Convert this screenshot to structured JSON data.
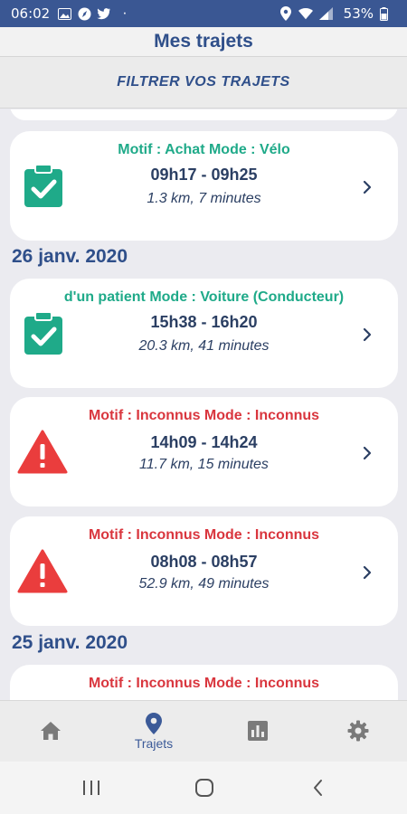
{
  "status_bar": {
    "time": "06:02",
    "battery": "53%",
    "dot": "·"
  },
  "header": {
    "title": "Mes trajets"
  },
  "filter": {
    "label": "FILTRER VOS TRAJETS"
  },
  "colors": {
    "primary": "#2f4f8a",
    "ok": "#1faa89",
    "warn": "#d9363e",
    "status_bar": "#3a5793"
  },
  "trips": [
    {
      "status": "ok",
      "icon": "clipboard-check-icon",
      "motif": "Motif : Achat  Mode : Vélo",
      "hours": "09h17 - 09h25",
      "details": "1.3 km, 7 minutes"
    },
    {
      "status": "ok",
      "icon": "clipboard-check-icon",
      "motif": "d'un patient  Mode : Voiture (Conducteur)",
      "hours": "15h38 - 16h20",
      "details": "20.3 km, 41 minutes"
    },
    {
      "status": "warn",
      "icon": "warning-triangle-icon",
      "motif": "Motif : Inconnus  Mode : Inconnus",
      "hours": "14h09 - 14h24",
      "details": "11.7 km, 15 minutes"
    },
    {
      "status": "warn",
      "icon": "warning-triangle-icon",
      "motif": "Motif : Inconnus  Mode : Inconnus",
      "hours": "08h08 - 08h57",
      "details": "52.9 km, 49 minutes"
    },
    {
      "status": "warn",
      "icon": "warning-triangle-icon",
      "motif": "Motif : Inconnus  Mode : Inconnus"
    }
  ],
  "dates": [
    "26 janv. 2020",
    "25 janv. 2020"
  ],
  "bottom_nav": [
    {
      "icon": "home-icon",
      "label": ""
    },
    {
      "icon": "location-pin-icon",
      "label": "Trajets",
      "active": true
    },
    {
      "icon": "bar-chart-icon",
      "label": ""
    },
    {
      "icon": "gear-icon",
      "label": ""
    }
  ],
  "system_nav": [
    "recent-apps-icon",
    "home-button-icon",
    "back-icon"
  ]
}
